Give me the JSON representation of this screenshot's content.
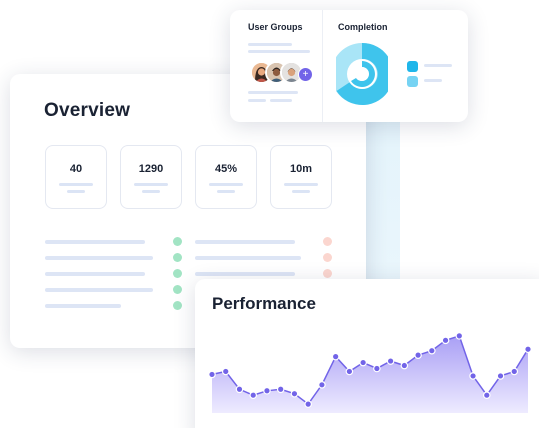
{
  "overview": {
    "title": "Overview",
    "stats": [
      {
        "value": "40"
      },
      {
        "value": "1290"
      },
      {
        "value": "45%"
      },
      {
        "value": "10m"
      }
    ]
  },
  "user_groups": {
    "title": "User Groups",
    "add_icon": "plus-icon"
  },
  "completion": {
    "title": "Completion"
  },
  "performance": {
    "title": "Performance"
  },
  "colors": {
    "accent": "#7264e8",
    "chart_fill_top": "#a99ff5",
    "chart_fill_bottom": "#eeebff",
    "donut_primary": "#3fc4ec",
    "donut_light": "#a9e5f7",
    "status_green": "#a2e4c4",
    "status_red": "#fbd6cf"
  },
  "chart_data": {
    "type": "area",
    "title": "Performance",
    "x": [
      1,
      2,
      3,
      4,
      5,
      6,
      7,
      8,
      9,
      10,
      11,
      12,
      13,
      14,
      15,
      16,
      17,
      18,
      19,
      20,
      21,
      22,
      23,
      24
    ],
    "values": [
      26,
      28,
      16,
      12,
      15,
      16,
      13,
      6,
      19,
      38,
      28,
      34,
      30,
      35,
      32,
      39,
      42,
      49,
      52,
      25,
      12,
      25,
      28,
      43
    ],
    "ylim": [
      0,
      60
    ],
    "grid": false,
    "legend": "none"
  }
}
